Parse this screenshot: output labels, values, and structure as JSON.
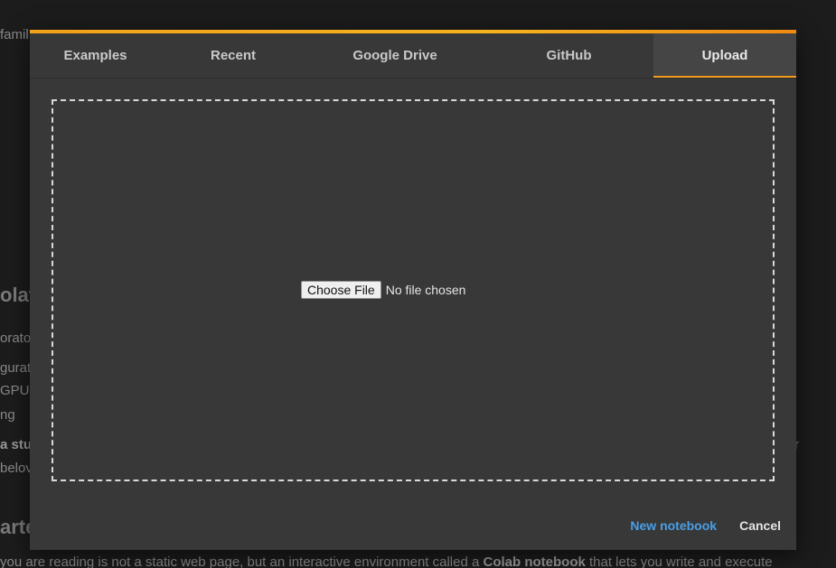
{
  "background": {
    "lines": [
      {
        "text": "famil",
        "bold": false
      },
      {
        "text": "olat",
        "bold": false
      },
      {
        "text": "orato",
        "bold": false
      },
      {
        "text": "gurat",
        "bold": false
      },
      {
        "text": "GPU",
        "bold": false
      },
      {
        "text": "ng",
        "bold": false
      },
      {
        "text": "a stud",
        "bold": true
      },
      {
        "text": "belov",
        "bold": false
      },
      {
        "text": "arte",
        "bold": false
      },
      {
        "text": "r",
        "bold": false
      }
    ],
    "bottom_line": {
      "prefix": "you are reading is not a static web page, but an interactive environment called a ",
      "bold": "Colab notebook",
      "suffix": " that lets you write and execute"
    }
  },
  "dialog": {
    "accent_color": "#f5a623",
    "tabs": [
      {
        "label": "Examples",
        "active": false
      },
      {
        "label": "Recent",
        "active": false
      },
      {
        "label": "Google Drive",
        "active": false
      },
      {
        "label": "GitHub",
        "active": false
      },
      {
        "label": "Upload",
        "active": true
      }
    ],
    "upload": {
      "choose_file_label": "Choose File",
      "file_status": "No file chosen"
    },
    "actions": {
      "new_notebook_label": "New notebook",
      "cancel_label": "Cancel",
      "new_notebook_color": "#4a9fe6"
    }
  }
}
